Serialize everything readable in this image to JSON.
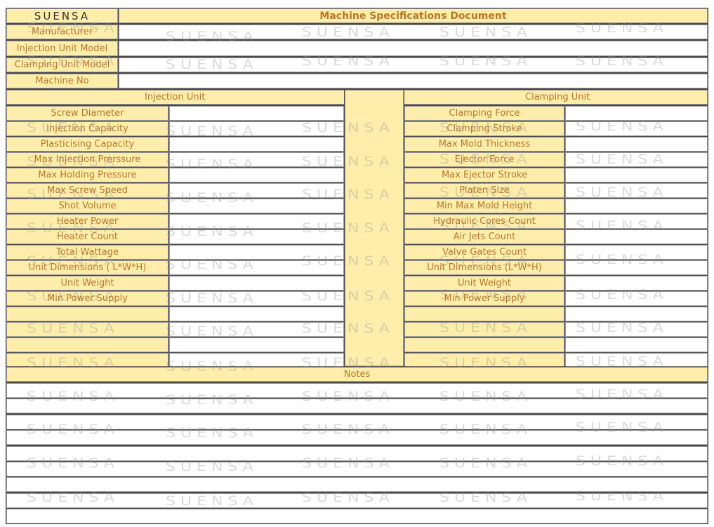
{
  "header": {
    "logo_text": "SUENSA",
    "title": "Machine Specifications Document"
  },
  "info_fields": [
    {
      "label": "Manufacturer",
      "value": ""
    },
    {
      "label": "Injection Unit Model",
      "value": ""
    },
    {
      "label": "Clamping Unit Model",
      "value": ""
    },
    {
      "label": "Machine No",
      "value": ""
    }
  ],
  "injection_unit": {
    "title": "Injection Unit",
    "rows": [
      {
        "label": "Screw Diameter",
        "value": ""
      },
      {
        "label": "Injection Capacity",
        "value": ""
      },
      {
        "label": "Plasticising Capacity",
        "value": ""
      },
      {
        "label": "Max Injection Prerssure",
        "value": ""
      },
      {
        "label": "Max Holding Pressure",
        "value": ""
      },
      {
        "label": "Max Screw Speed",
        "value": ""
      },
      {
        "label": "Shot Volume",
        "value": ""
      },
      {
        "label": "Heater Power",
        "value": ""
      },
      {
        "label": "Heater Count",
        "value": ""
      },
      {
        "label": "Total Wattage",
        "value": ""
      },
      {
        "label": "Unit Dimensions ( L*W*H)",
        "value": ""
      },
      {
        "label": "Unit Weight",
        "value": ""
      },
      {
        "label": "Min Power Supply",
        "value": ""
      },
      {
        "label": "",
        "value": ""
      },
      {
        "label": "",
        "value": ""
      },
      {
        "label": "",
        "value": ""
      },
      {
        "label": "",
        "value": ""
      }
    ]
  },
  "clamping_unit": {
    "title": "Clamping Unit",
    "rows": [
      {
        "label": "Clamping Force",
        "value": ""
      },
      {
        "label": "Clamping Stroke",
        "value": ""
      },
      {
        "label": "Max Mold Thickness",
        "value": ""
      },
      {
        "label": "Ejector Force",
        "value": ""
      },
      {
        "label": "Max Ejector Stroke",
        "value": ""
      },
      {
        "label": "Platen Size",
        "value": ""
      },
      {
        "label": "Min Max Mold Height",
        "value": ""
      },
      {
        "label": "Hydraulic Cores Count",
        "value": ""
      },
      {
        "label": "Air Jets Count",
        "value": ""
      },
      {
        "label": "Valve Gates Count",
        "value": ""
      },
      {
        "label": "Unit Dimensions (L*W*H)",
        "value": ""
      },
      {
        "label": "Unit Weight",
        "value": ""
      },
      {
        "label": "Min Power Supply",
        "value": ""
      },
      {
        "label": "",
        "value": ""
      },
      {
        "label": "",
        "value": ""
      },
      {
        "label": "",
        "value": ""
      },
      {
        "label": "",
        "value": ""
      }
    ]
  },
  "notes": {
    "title": "Notes",
    "lines": [
      "",
      "",
      "",
      "",
      "",
      "",
      "",
      "",
      ""
    ]
  },
  "watermark": {
    "text": "SUENSA"
  },
  "colors": {
    "header_fill": "#ffeeab",
    "label_text": "#b8762a",
    "border": "#4a4a4a"
  }
}
